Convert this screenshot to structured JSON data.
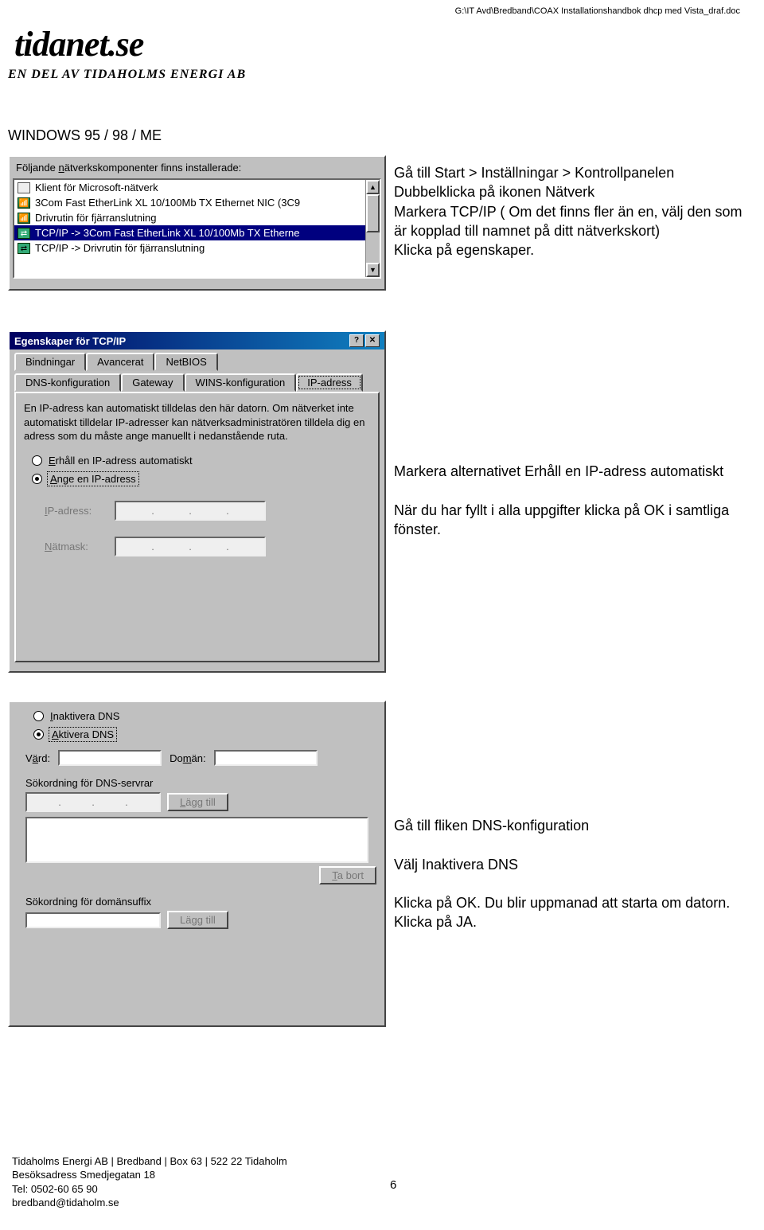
{
  "header_path": "G:\\IT Avd\\Bredband\\COAX Installationshandbok dhcp med Vista_draf.doc",
  "logo": {
    "text": "tidanet.se",
    "tagline": "EN DEL AV TIDAHOLMS ENERGI AB"
  },
  "section_title": "WINDOWS 95 / 98 / ME",
  "panel1": {
    "label_pre": "Följande ",
    "label_underline": "n",
    "label_post": "ätverkskomponenter finns installerade:",
    "items": [
      "Klient för Microsoft-nätverk",
      "3Com Fast EtherLink XL 10/100Mb TX Ethernet NIC (3C9",
      "Drivrutin för fjärranslutning",
      "TCP/IP -> 3Com Fast EtherLink XL 10/100Mb TX Etherne",
      "TCP/IP -> Drivrutin för fjärranslutning"
    ],
    "scroll_up": "▲",
    "scroll_down": "▼"
  },
  "instr1": "Gå till Start > Inställningar > Kontrollpanelen\nDubbelklicka på ikonen Nätverk\nMarkera TCP/IP ( Om det finns fler än en, välj den som är kopplad  till namnet på ditt nätverkskort)\nKlicka på egenskaper.",
  "panel2": {
    "title": "Egenskaper för TCP/IP",
    "btn_help": "?",
    "btn_close": "✕",
    "tabs_row1": [
      "Bindningar",
      "Avancerat",
      "NetBIOS"
    ],
    "tabs_row2": [
      "DNS-konfiguration",
      "Gateway",
      "WINS-konfiguration",
      "IP-adress"
    ],
    "active_tab": "IP-adress",
    "desc": "En IP-adress kan automatiskt tilldelas den här datorn. Om nätverket inte automatiskt tilldelar IP-adresser kan nätverksadministratören tilldela dig en adress som du måste ange manuellt i nedanstående ruta.",
    "radio1": "Erhåll en IP-adress automatiskt",
    "radio2": "Ange en IP-adress",
    "field_ip": "IP-adress:",
    "field_mask": "Nätmask:",
    "dot": "."
  },
  "instr2": "Markera alternativet Erhåll en IP-adress automatiskt\n\nNär du har fyllt i alla uppgifter klicka på OK i samtliga fönster.",
  "panel3": {
    "radio_inactive": "Inaktivera DNS",
    "radio_active": "Aktivera DNS",
    "label_host_pre": "V",
    "label_host_u": "ä",
    "label_host_post": "rd:",
    "label_domain_pre": "Do",
    "label_domain_u": "m",
    "label_domain_post": "än:",
    "group1": "Sökordning för DNS-servrar",
    "btn_add": "Lägg till",
    "btn_remove": "Ta bort",
    "group2": "Sökordning för domänsuffix",
    "btn_add2": "Lägg till",
    "dot": "."
  },
  "instr3": "Gå till fliken DNS-konfiguration\n\nVälj Inaktivera DNS\n\nKlicka på OK. Du blir uppmanad att starta om datorn. Klicka på JA.",
  "footer": {
    "line1": "Tidaholms Energi AB | Bredband | Box 63 | 522 22 Tidaholm",
    "line2": "Besöksadress Smedjegatan 18",
    "line3": "Tel: 0502-60 65 90",
    "line4": "bredband@tidaholm.se"
  },
  "page_number": "6"
}
